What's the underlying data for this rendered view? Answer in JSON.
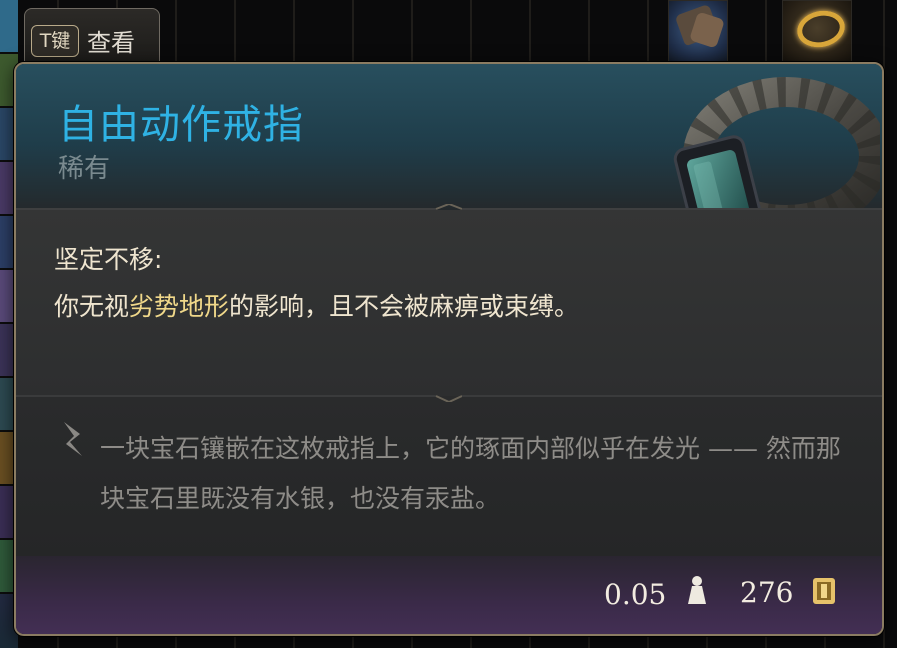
{
  "inspect_tab": {
    "key": "T键",
    "label": "查看"
  },
  "item": {
    "name": "自由动作戒指",
    "rarity": "稀有",
    "name_color": "#2fb2e4"
  },
  "passive": {
    "title": "坚定不移:",
    "desc_before": "你无视",
    "desc_highlight": "劣势地形",
    "desc_after": "的影响，且不会被麻痹或束缚。"
  },
  "lore": "一块宝石镶嵌在这枚戒指上，它的琢面内部似乎在发光 —— 然而那块宝石里既没有水银，也没有汞盐。",
  "footer": {
    "weight": "0.05",
    "price": "276",
    "weight_icon": "weight-icon",
    "coin_icon": "gold-coin-icon"
  }
}
